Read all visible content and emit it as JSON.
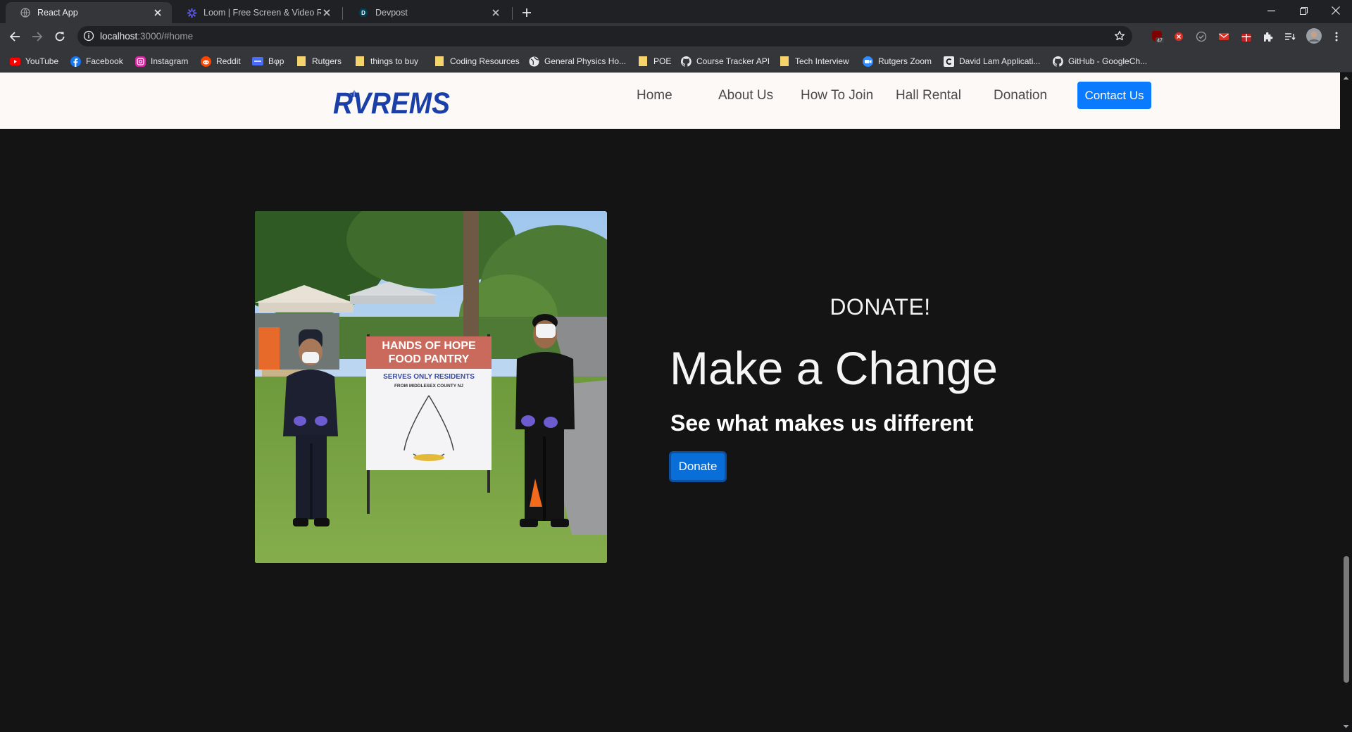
{
  "browser": {
    "tabs": [
      {
        "title": "React App",
        "active": true
      },
      {
        "title": "Loom | Free Screen & Video Rec",
        "active": false
      },
      {
        "title": "Devpost",
        "active": false
      }
    ],
    "url_host": "localhost",
    "url_path": ":3000/#home",
    "extension_badge": "47",
    "bookmarks": [
      {
        "label": "YouTube",
        "icon": "youtube-icon"
      },
      {
        "label": "Facebook",
        "icon": "facebook-icon"
      },
      {
        "label": "Instagram",
        "icon": "instagram-icon"
      },
      {
        "label": "Reddit",
        "icon": "reddit-icon"
      },
      {
        "label": "Bφp",
        "icon": "bookmark-app-icon"
      },
      {
        "label": "Rutgers",
        "icon": "folder-icon"
      },
      {
        "label": "things to buy",
        "icon": "folder-icon"
      },
      {
        "label": "Coding Resources",
        "icon": "folder-icon"
      },
      {
        "label": "General Physics Ho...",
        "icon": "globe-icon"
      },
      {
        "label": "POE",
        "icon": "folder-icon"
      },
      {
        "label": "Course Tracker API",
        "icon": "github-icon"
      },
      {
        "label": "Tech Interview",
        "icon": "folder-icon"
      },
      {
        "label": "Rutgers Zoom",
        "icon": "zoom-icon"
      },
      {
        "label": "David Lam Applicati...",
        "icon": "page-icon"
      },
      {
        "label": "GitHub - GoogleCh...",
        "icon": "github-icon"
      }
    ]
  },
  "site": {
    "logo_text": "RVREMS",
    "nav": [
      "Home",
      "About Us",
      "How To Join",
      "Hall Rental",
      "Donation"
    ],
    "contact_label": "Contact Us"
  },
  "hero": {
    "photo_sign": [
      "HANDS OF HOPE",
      "FOOD PANTRY",
      "SERVES ONLY RESIDENTS",
      "FROM MIDDLESEX COUNTY NJ"
    ],
    "kicker": "DONATE!",
    "headline": "Make a Change",
    "subhead": "See what makes us different",
    "button": "Donate"
  },
  "colors": {
    "accent": "#0a7bff",
    "page_bg": "#141414",
    "nav_bg": "#fdf9f6",
    "logo_blue": "#1a3fa8"
  }
}
